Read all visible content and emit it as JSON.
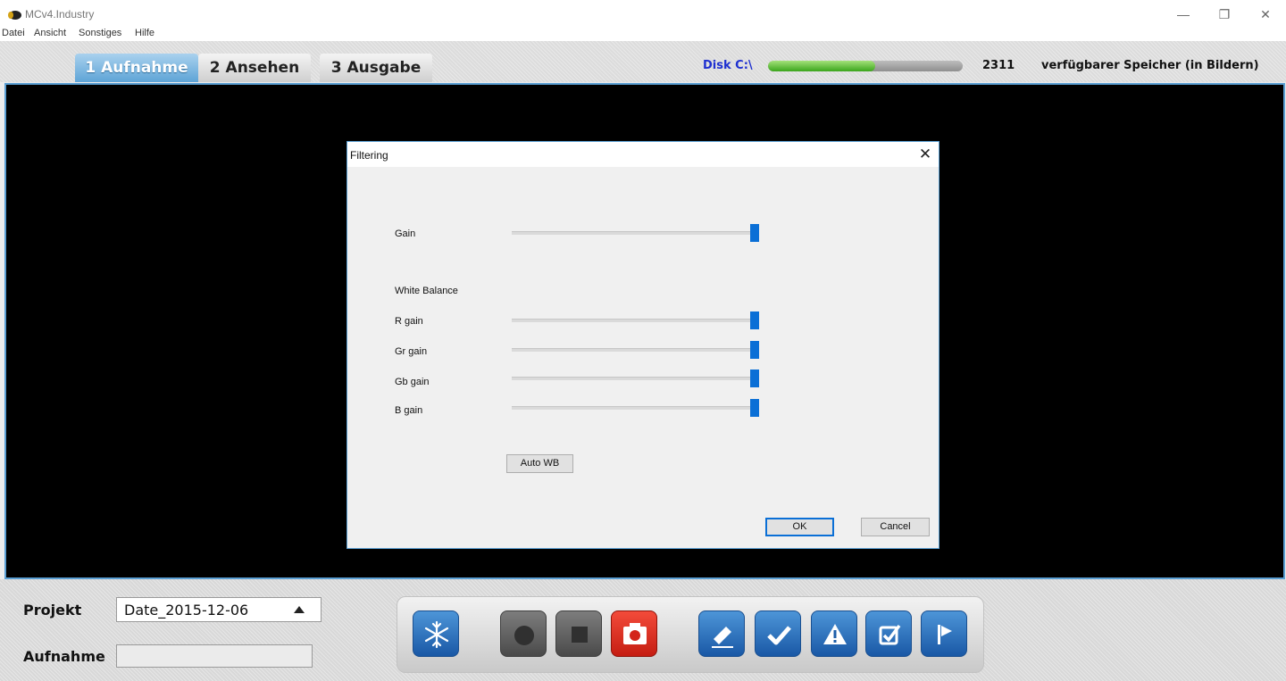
{
  "window": {
    "title": "MCv4.Industry",
    "minimize_glyph": "—",
    "maximize_glyph": "❐",
    "close_glyph": "✕"
  },
  "menu": [
    "Datei",
    "Ansicht",
    "Sonstiges",
    "Hilfe"
  ],
  "tabs": [
    {
      "label": "1 Aufnahme",
      "active": true
    },
    {
      "label": "2 Ansehen",
      "active": false
    },
    {
      "label": "3 Ausgabe",
      "active": false
    }
  ],
  "disk": {
    "label": "Disk C:\\",
    "fill_fraction": 0.55,
    "count": "2311",
    "description": "verfügbarer Speicher (in Bildern)"
  },
  "dialog": {
    "title": "Filtering",
    "close_glyph": "✕",
    "gain_label": "Gain",
    "white_balance_label": "White Balance",
    "sliders": [
      {
        "label": "Gain",
        "value_fraction": 1.0
      },
      {
        "label": "R gain",
        "value_fraction": 1.0
      },
      {
        "label": "Gr gain",
        "value_fraction": 1.0
      },
      {
        "label": "Gb gain",
        "value_fraction": 1.0
      },
      {
        "label": "B gain",
        "value_fraction": 1.0
      }
    ],
    "auto_wb_label": "Auto WB",
    "ok_label": "OK",
    "cancel_label": "Cancel"
  },
  "bottom": {
    "projekt_label": "Projekt",
    "projekt_value": "Date_2015-12-06",
    "aufnahme_label": "Aufnahme",
    "aufnahme_value": ""
  },
  "toolbar": {
    "buttons": [
      {
        "icon": "snowflake-icon",
        "color": "blue"
      },
      {
        "icon": "record-icon",
        "color": "gray"
      },
      {
        "icon": "stop-icon",
        "color": "gray"
      },
      {
        "icon": "camera-icon",
        "color": "red"
      },
      {
        "icon": "eraser-icon",
        "color": "blue"
      },
      {
        "icon": "check-icon",
        "color": "blue"
      },
      {
        "icon": "warning-icon",
        "color": "blue"
      },
      {
        "icon": "checkbox-icon",
        "color": "blue"
      },
      {
        "icon": "flag-icon",
        "color": "blue"
      }
    ]
  },
  "colors": {
    "accent": "#5b9fd3",
    "slider_thumb": "#0a6fd6",
    "disk_label": "#1e30d0",
    "disk_fill": "#3ba51c",
    "camera_red": "#e3291c"
  }
}
